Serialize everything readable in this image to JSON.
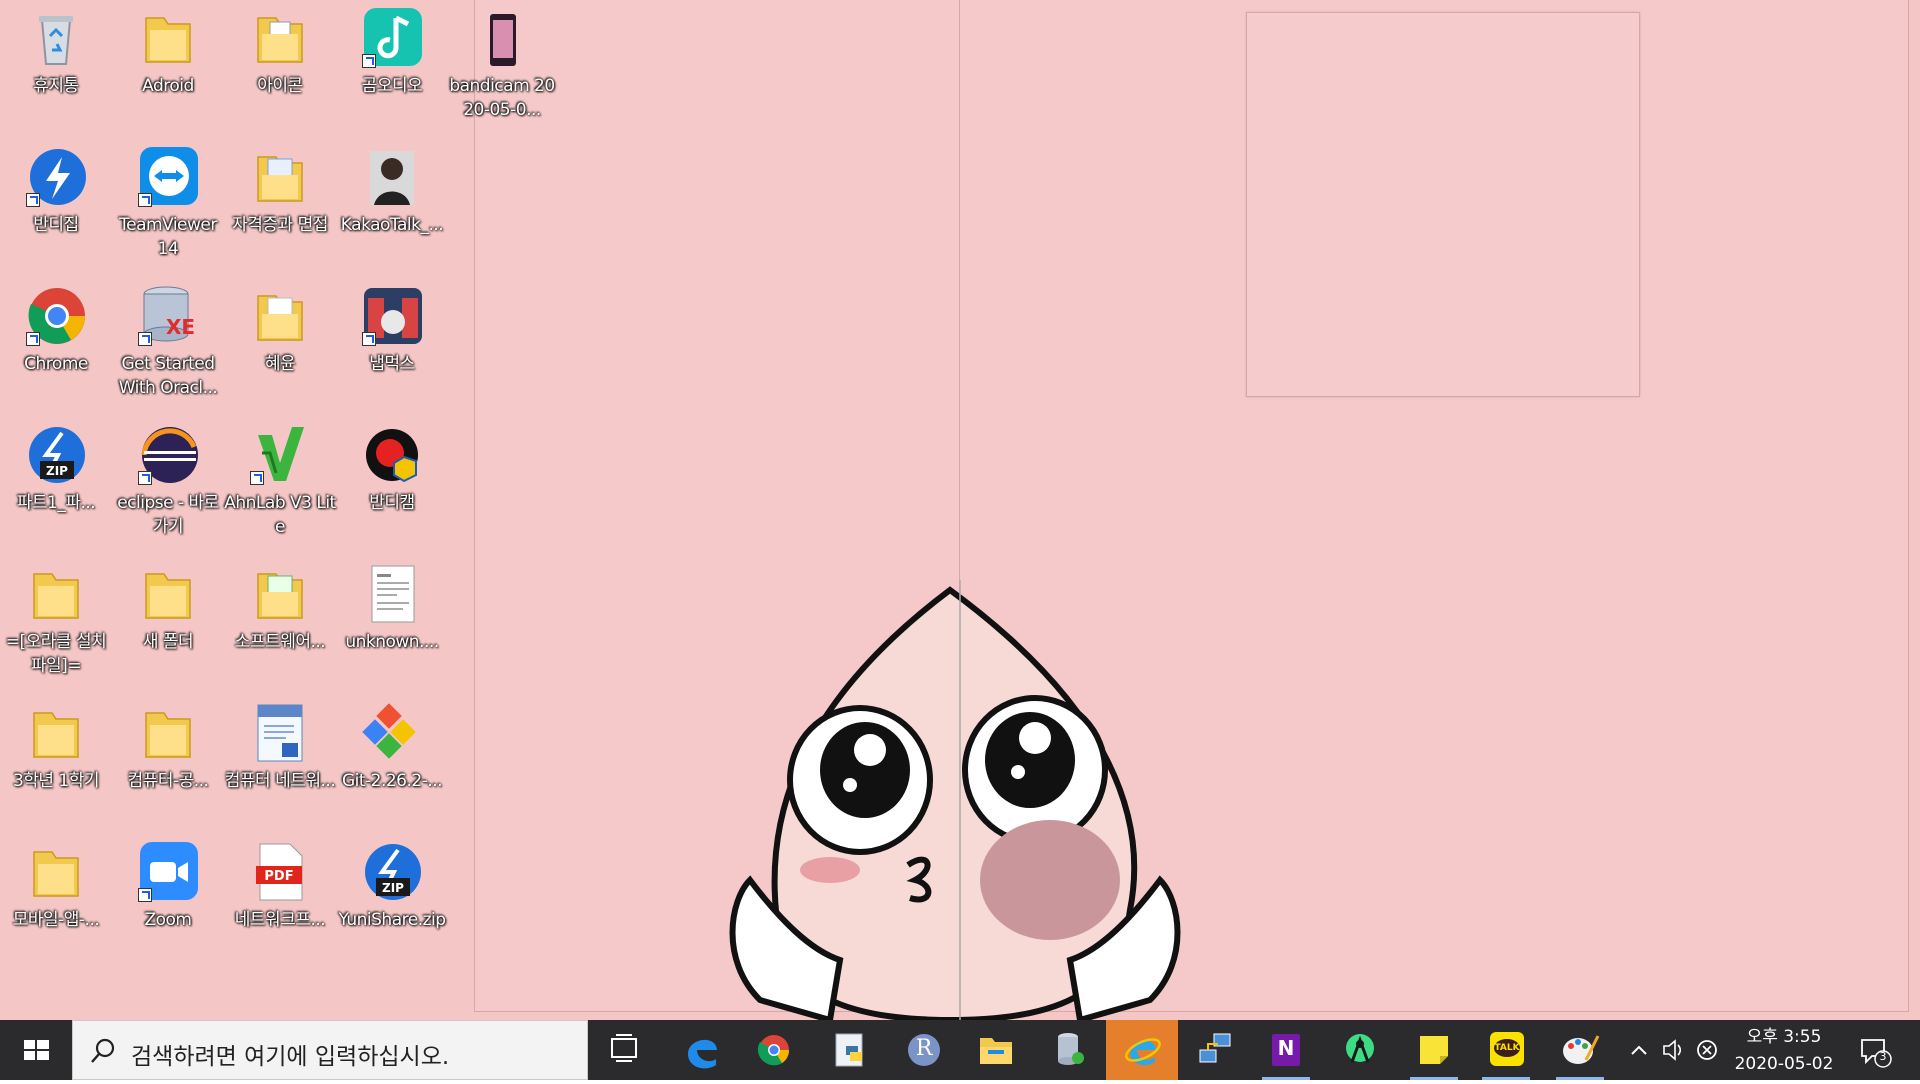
{
  "desktop": {
    "icons": [
      {
        "label": "휴지통"
      },
      {
        "label": "Adroid"
      },
      {
        "label": "아이콘"
      },
      {
        "label": "곰오디오"
      },
      {
        "label": "bandicam 2020-05-0..."
      },
      {
        "label": "반디집"
      },
      {
        "label": "TeamViewer 14"
      },
      {
        "label": "자격증과 면접"
      },
      {
        "label": "KakaoTalk_..."
      },
      {
        "label": "Chrome"
      },
      {
        "label": "Get Started With Oracl..."
      },
      {
        "label": "혜윤"
      },
      {
        "label": "냅먹스"
      },
      {
        "label": "파트1_파..."
      },
      {
        "label": "eclipse - 바로 가기"
      },
      {
        "label": "AhnLab V3 Lite"
      },
      {
        "label": "반디캠"
      },
      {
        "label": "=[오라클 설치 파일]="
      },
      {
        "label": "새 폴더"
      },
      {
        "label": "소프트웨어..."
      },
      {
        "label": "unknown...."
      },
      {
        "label": "3학년 1학기"
      },
      {
        "label": "컴퓨터-공..."
      },
      {
        "label": "컴퓨터 네트워..."
      },
      {
        "label": "Git-2.26.2-..."
      },
      {
        "label": "모바일-앱-..."
      },
      {
        "label": "Zoom"
      },
      {
        "label": "네트워크프..."
      },
      {
        "label": "YuniShare.zip"
      }
    ]
  },
  "taskbar": {
    "search_placeholder": "검색하려면 여기에 입력하십시오.",
    "apps": [
      {
        "icon": "task-view-icon"
      },
      {
        "icon": "edge-icon"
      },
      {
        "icon": "chrome-icon"
      },
      {
        "icon": "python-icon"
      },
      {
        "icon": "r-icon",
        "text": "R"
      },
      {
        "icon": "file-explorer-icon"
      },
      {
        "icon": "database-icon"
      },
      {
        "icon": "internet-explorer-icon"
      },
      {
        "icon": "network-icon"
      },
      {
        "icon": "onenote-icon",
        "text": "N"
      },
      {
        "icon": "android-studio-icon"
      },
      {
        "icon": "sticky-notes-icon"
      },
      {
        "icon": "kakaotalk-icon",
        "text": "TALK"
      },
      {
        "icon": "paint-icon"
      }
    ],
    "clock": {
      "time": "오후 3:55",
      "date": "2020-05-02"
    },
    "notification_count": "3"
  },
  "colors": {
    "wallpaper": "#f4c6c6",
    "taskbar": "#2b2b2e",
    "active_app": "#e57f2c"
  }
}
